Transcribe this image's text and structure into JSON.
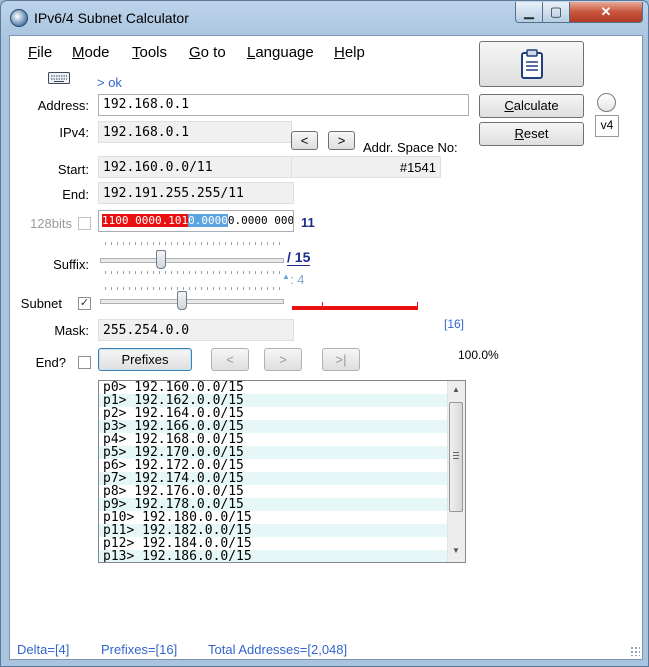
{
  "window": {
    "title": "IPv6/4 Subnet Calculator",
    "min_glyph": "▁",
    "max_glyph": "▢",
    "close_glyph": "✕"
  },
  "menu": [
    {
      "label": "File",
      "key": "F",
      "rest": "ile"
    },
    {
      "label": "Mode",
      "key": "M",
      "rest": "ode"
    },
    {
      "label": "Tools",
      "key": "T",
      "rest": "ools"
    },
    {
      "label": "Go to",
      "key": "G",
      "rest": "o to"
    },
    {
      "label": "Language",
      "key": "L",
      "rest": "anguage"
    },
    {
      "label": "Help",
      "key": "H",
      "rest": "elp"
    }
  ],
  "keyboard_hint": "> ok",
  "address": {
    "label": "Address:",
    "value": "192.168.0.1"
  },
  "ipv4": {
    "label": "IPv4:",
    "value": "192.168.0.1"
  },
  "nav_prev": "<",
  "nav_next": ">",
  "addr_space": {
    "label": "Addr. Space No:",
    "value": "#1541"
  },
  "start": {
    "label": "Start:",
    "value": "192.160.0.0/11"
  },
  "end": {
    "label": "End:",
    "value": "192.191.255.255/11"
  },
  "bits128": {
    "label": "128bits",
    "checked": false
  },
  "bits": {
    "red": "1100 0000.101",
    "blue": "0.0000",
    "rest": "0.0000 0000.0000",
    "prefix_len": "11"
  },
  "suffix": {
    "label": "Suffix:",
    "value": "/ 15",
    "delta": ": 4",
    "delta_arrow": "▲"
  },
  "subnet": {
    "label": "Subnet",
    "checked": true
  },
  "mask": {
    "label": "Mask:",
    "value": "255.254.0.0",
    "bracket": "[16]"
  },
  "end_q": {
    "label": "End?",
    "checked": false
  },
  "prefixes_button": "Prefixes",
  "page_prev": "<",
  "page_next": ">",
  "page_last": ">|",
  "percent": "100.0%",
  "buttons": {
    "calculate": "Calculate",
    "calc_key": "C",
    "calc_rest": "alculate",
    "reset": "Reset",
    "reset_key": "R",
    "reset_rest": "eset",
    "v4": "v4"
  },
  "prefix_list": [
    "p0> 192.160.0.0/15",
    "p1> 192.162.0.0/15",
    "p2> 192.164.0.0/15",
    "p3> 192.166.0.0/15",
    "p4> 192.168.0.0/15",
    "p5> 192.170.0.0/15",
    "p6> 192.172.0.0/15",
    "p7> 192.174.0.0/15",
    "p8> 192.176.0.0/15",
    "p9> 192.178.0.0/15",
    "p10> 192.180.0.0/15",
    "p11> 192.182.0.0/15",
    "p12> 192.184.0.0/15",
    "p13> 192.186.0.0/15"
  ],
  "status": {
    "delta": "Delta=[4]",
    "prefixes": "Prefixes=[16]",
    "total": "Total Addresses=[2,048]"
  },
  "colors": {
    "bits_red": "#e81010",
    "bits_blue": "#5ba4e0",
    "link_blue": "#3366cc",
    "accent_navy": "#1a2b8c"
  }
}
